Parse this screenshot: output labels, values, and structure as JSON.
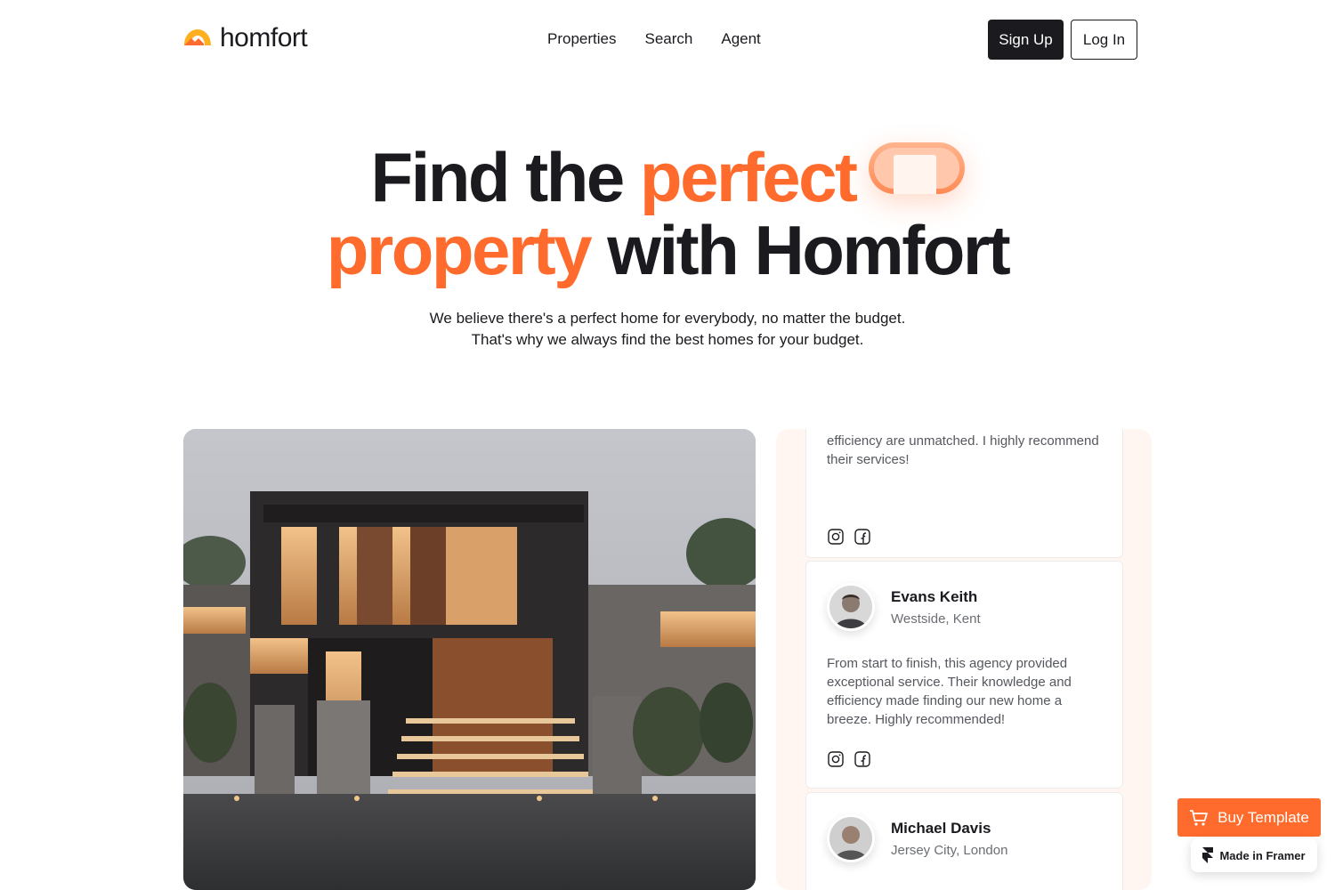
{
  "brand": {
    "name": "homfort",
    "accent": "#ff6b2c",
    "dark": "#1a1a1f"
  },
  "nav": {
    "links": [
      "Properties",
      "Search",
      "Agent"
    ],
    "signup_label": "Sign Up",
    "login_label": "Log In"
  },
  "hero": {
    "line1_dark": "Find the ",
    "line1_accent": "perfect",
    "line2_accent": "property",
    "line2_dark": " with Homfort",
    "sub_line1": "We believe there's a perfect home for everybody, no matter the budget.",
    "sub_line2": "That's why we always find the best homes for your budget."
  },
  "testimonials": [
    {
      "quote": "This agency transformed our home search into a stress-free journey. Their expertise and efficiency are unmatched. I highly recommend their services!",
      "socials": [
        "instagram-icon",
        "facebook-icon"
      ]
    },
    {
      "name": "Evans Keith",
      "location": "Westside, Kent",
      "quote": "From start to finish, this agency provided exceptional service. Their knowledge and efficiency made finding our new home a breeze. Highly recommended!",
      "socials": [
        "instagram-icon",
        "facebook-icon"
      ]
    },
    {
      "name": "Michael Davis",
      "location": "Jersey City, London"
    }
  ],
  "floating": {
    "buy_label": "Buy Template",
    "framer_label": "Made in Framer"
  }
}
